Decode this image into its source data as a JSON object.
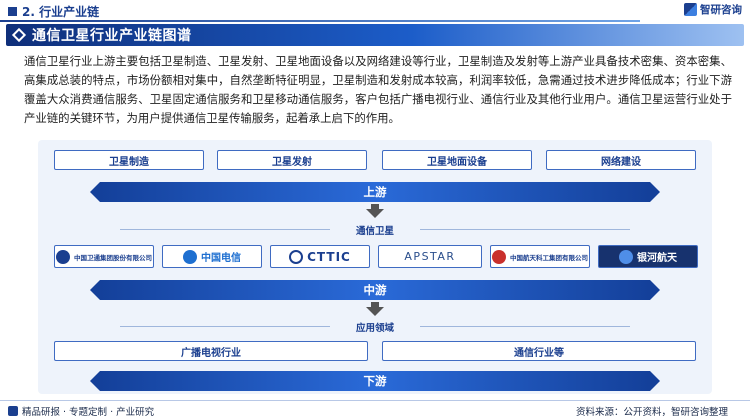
{
  "header": {
    "section_title": "2. 行业产业链",
    "brand": "智研咨询"
  },
  "banner": {
    "title": "通信卫星行业产业链图谱"
  },
  "intro": "通信卫星行业上游主要包括卫星制造、卫星发射、卫星地面设备以及网络建设等行业，卫星制造及发射等上游产业具备技术密集、资本密集、高集成总装的特点，市场份额相对集中，自然垄断特征明显，卫星制造和发射成本较高，利润率较低，急需通过技术进步降低成本；行业下游覆盖大众消费通信服务、卫星固定通信服务和卫星移动通信服务，客户包括广播电视行业、通信行业及其他行业用户。通信卫星运营行业处于产业链的关键环节，为用户提供通信卫星传输服务，起着承上启下的作用。",
  "diagram": {
    "upstream_items": [
      "卫星制造",
      "卫星发射",
      "卫星地面设备",
      "网络建设"
    ],
    "upstream_label": "上游",
    "midstream_sub": "通信卫星",
    "companies": [
      {
        "name": "中国卫通集团股份有限公司",
        "icon": "china-satcom-logo",
        "color": "#1b3f8f"
      },
      {
        "name": "中国电信",
        "icon": "china-telecom-logo",
        "color": "#1e6fd0"
      },
      {
        "name": "CTTIC",
        "icon": "cttic-logo",
        "color": "#1b3f8f"
      },
      {
        "name": "APSTAR",
        "icon": "apstar-logo",
        "color": "#2a4e8c"
      },
      {
        "name": "中国航天科工集团有限公司",
        "icon": "casic-logo",
        "color": "#1b3f8f"
      },
      {
        "name": "银河航天",
        "icon": "galaxyspace-logo",
        "color": "#ffffff"
      }
    ],
    "midstream_label": "中游",
    "downstream_sub": "应用领域",
    "downstream_items": [
      "广播电视行业",
      "通信行业等"
    ],
    "downstream_label": "下游"
  },
  "footer": {
    "left": "精品研报 · 专题定制 · 产业研究",
    "source": "资料来源：公开资料，智研咨询整理"
  }
}
